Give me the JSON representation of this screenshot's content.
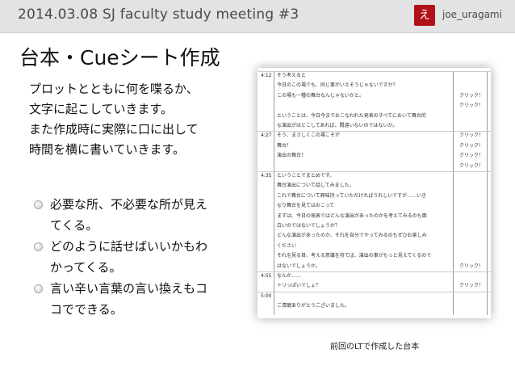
{
  "header": {
    "title": "2014.03.08   SJ faculty study meeting #3",
    "author": "joe_uragami",
    "logo_glyph": "え"
  },
  "slide": {
    "title": "台本・Cueシート作成",
    "intro_lines": [
      "プロットとともに何を喋るか、",
      "文字に起こしていきます。",
      "また作成時に実際に口に出して",
      "時間を横に書いていきます。"
    ],
    "bullets": [
      [
        "必要な所、不必要な所が見え",
        "てくる。"
      ],
      [
        "どのように話せばいいかもわ",
        "かってくる。"
      ],
      [
        "言い辛い言葉の言い換えもコ",
        "コでできる。"
      ]
    ]
  },
  "script_image": {
    "caption": "前回のLTで作成した台本",
    "rows": [
      {
        "time": "4:12",
        "text": "そう考えると",
        "cue": ""
      },
      {
        "time": "",
        "text": "今日のこの場でも、同じ事がいえそうじゃないですか？",
        "cue": ""
      },
      {
        "time": "",
        "text": "この場も一種の舞台なんじゃないかと。",
        "cue": "クリック！"
      },
      {
        "time": "",
        "text": "",
        "cue": "クリック！"
      },
      {
        "time": "",
        "text": "ということは、今日今までおこなわれた発表のすべてにおいて舞台的",
        "cue": ""
      },
      {
        "time": "",
        "text": "な演出がほどこしてあれば、間違いないのではないか。",
        "cue": ""
      },
      {
        "time": "4:27",
        "text": "そう、まさしくこの場こそが",
        "cue": "クリック！"
      },
      {
        "time": "",
        "text": "舞台！",
        "cue": "クリック！"
      },
      {
        "time": "",
        "text": "演出の舞台！",
        "cue": "クリック！"
      },
      {
        "time": "",
        "text": "",
        "cue": "クリック！"
      },
      {
        "time": "4:35",
        "text": "ということでまとめです。",
        "cue": ""
      },
      {
        "time": "",
        "text": "舞台演出について話してみました。",
        "cue": ""
      },
      {
        "time": "",
        "text": "これで舞台について興味持っていただければうれしいですが……いき",
        "cue": ""
      },
      {
        "time": "",
        "text": "なり舞台を見てはおこって",
        "cue": ""
      },
      {
        "time": "",
        "text": "まずは、今日の発表ではどんな演出があったのかを考えてみるのも面",
        "cue": ""
      },
      {
        "time": "",
        "text": "白いのではないでしょうか？",
        "cue": ""
      },
      {
        "time": "",
        "text": "どんな演出があったのか、それを自分でやってみるのもぜひお楽しみ",
        "cue": ""
      },
      {
        "time": "",
        "text": "ください",
        "cue": ""
      },
      {
        "time": "",
        "text": "それを見る目、考える意識を持てば、演出の事がもっと見えてくるので",
        "cue": ""
      },
      {
        "time": "",
        "text": "はないでしょうか。",
        "cue": "クリック！"
      },
      {
        "time": "4:55",
        "text": "なんか……",
        "cue": ""
      },
      {
        "time": "",
        "text": "トリっぽいでしょ？",
        "cue": "クリック！"
      },
      {
        "time": "5:00",
        "text": "",
        "cue": ""
      },
      {
        "time": "",
        "text": "ご清聴ありがとうございました。",
        "cue": ""
      }
    ]
  }
}
